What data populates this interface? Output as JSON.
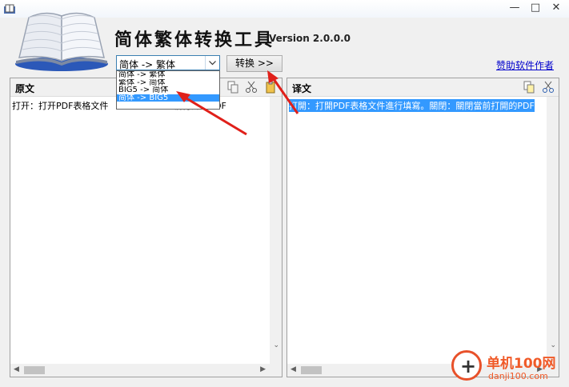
{
  "window": {
    "controls": {
      "minimize": "—",
      "maximize": "□",
      "close": "✕"
    }
  },
  "header": {
    "title": "简体繁体转换工具",
    "version": "Version 2.0.0.0",
    "logo_icon": "open-book-icon"
  },
  "conversion": {
    "selected": "简体 -> 繁体",
    "options": [
      "简体 -> 繁体",
      "繁体 -> 简体",
      "BIG5 -> 简体",
      "简体 -> BIG5"
    ],
    "highlighted_index": 3,
    "convert_label": "转换 >>"
  },
  "sponsor_link": "赞助软件作者",
  "source_pane": {
    "label": "原文",
    "text_before": "打开：打开PDF表格文件",
    "text_after": "前打开的PDF"
  },
  "target_pane": {
    "label": "译文",
    "text": "打開：打開PDF表格文件進行填寫。關閉：關閉當前打開的PDF"
  },
  "watermark": {
    "brand": "单机100网",
    "url": "danji100.com"
  },
  "colors": {
    "accent": "#3399ff",
    "annotation": "#e0201a",
    "link": "#0000cc",
    "watermark": "#f05a28"
  }
}
